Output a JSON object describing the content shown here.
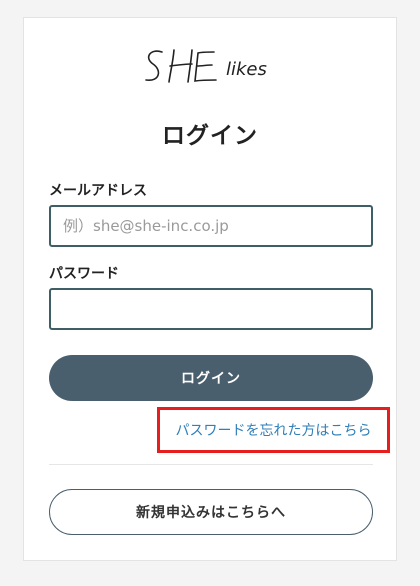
{
  "brand": {
    "name": "SHE likes"
  },
  "page": {
    "title": "ログイン"
  },
  "form": {
    "email_label": "メールアドレス",
    "email_placeholder": "例）she@she-inc.co.jp",
    "email_value": "",
    "password_label": "パスワード",
    "password_value": "",
    "login_button": "ログイン"
  },
  "links": {
    "forgot_password": "パスワードを忘れた方はこちら"
  },
  "signup": {
    "button": "新規申込みはこちらへ"
  },
  "colors": {
    "primary_button": "#4a5f6d",
    "input_border": "#3f5f66",
    "link": "#2f7fb8",
    "highlight": "#e61e1e"
  }
}
